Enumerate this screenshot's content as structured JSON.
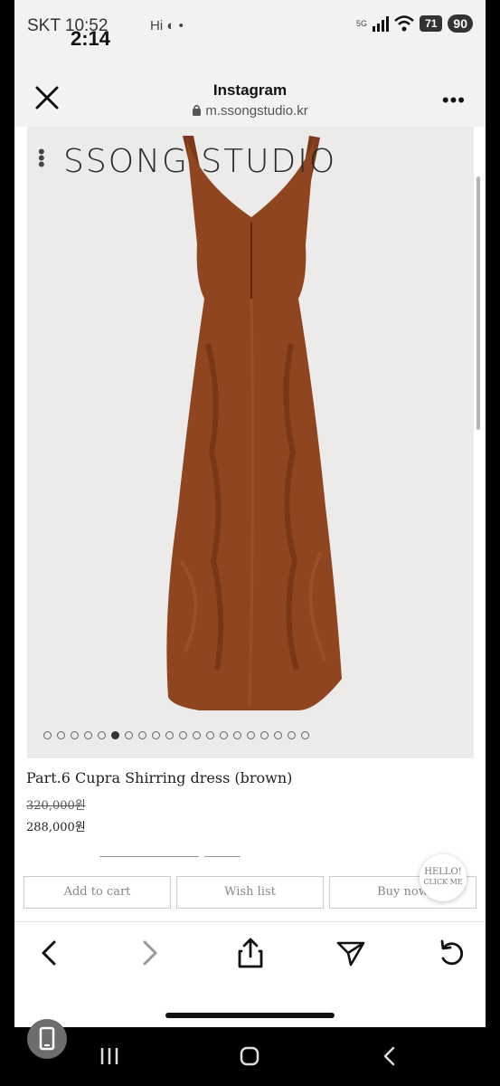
{
  "status_bar": {
    "carrier": "SKT 10:52",
    "time": "2:14",
    "left_icons": "Hi",
    "network": "5G",
    "battery_badge": "90",
    "battery_level": "71"
  },
  "browser_header": {
    "title": "Instagram",
    "url": "m.ssongstudio.kr"
  },
  "gallery": {
    "brand": "SSONG STUDIO",
    "dot_count": 20,
    "active_dot": 5,
    "dress_color": "#8e4520"
  },
  "product": {
    "name": "Part.6 Cupra Shirring dress (brown)",
    "original_price": "320,000원",
    "sale_price": "288,000원"
  },
  "actions": {
    "add_to_cart": "Add to cart",
    "wish_list": "Wish list",
    "buy_now": "Buy now"
  },
  "chat_bubble": {
    "line1": "HELLO!",
    "line2": "CLICK ME"
  },
  "toolbar": {
    "icons": [
      "back-icon",
      "forward-icon",
      "share-icon",
      "send-icon",
      "reload-icon"
    ]
  }
}
